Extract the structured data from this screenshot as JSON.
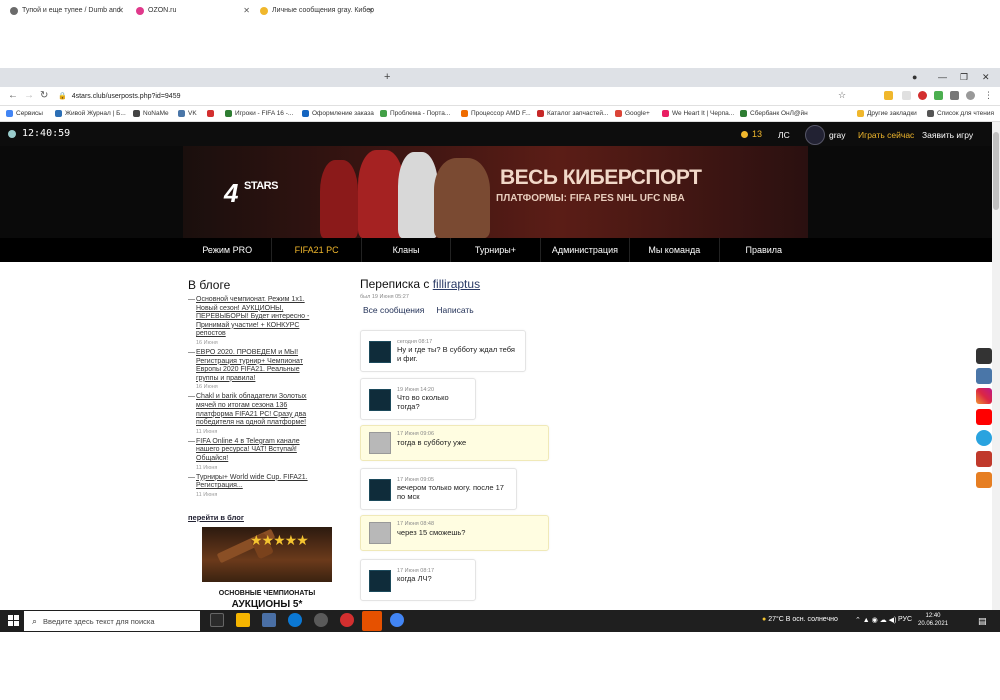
{
  "browser": {
    "tabs": [
      {
        "title": "Тупой и еще тупее / Dumb and",
        "icon_color": "#6b6b6b"
      },
      {
        "title": "OZON.ru",
        "icon_color": "#e0398b"
      },
      {
        "title": "Личные сообщения gray. Кибер",
        "icon_color": "#f0b72c"
      }
    ],
    "new_tab": "+",
    "url": "4stars.club/userposts.php?id=9459",
    "bookmarks": [
      {
        "label": "Сервисы",
        "color": "#4285f4"
      },
      {
        "label": "Живой Журнал | Б...",
        "color": "#2c6fb5"
      },
      {
        "label": "NoNaMe",
        "color": "#444444"
      },
      {
        "label": "VK",
        "color": "#4a76a8"
      },
      {
        "label": "",
        "color": "#d32f2f"
      },
      {
        "label": "Игроки - FIFA 16 -...",
        "color": "#2e7d32"
      },
      {
        "label": "Оформление заказа",
        "color": "#1565c0"
      },
      {
        "label": "Проблема - Порта...",
        "color": "#43a047"
      },
      {
        "label": "Процессор AMD F...",
        "color": "#ef6c00"
      },
      {
        "label": "Каталог запчастей...",
        "color": "#c62828"
      },
      {
        "label": "Google+",
        "color": "#db4437"
      },
      {
        "label": "We Heart It | Черпа...",
        "color": "#e91e63"
      },
      {
        "label": "Сбербанк ОнЛ@йн",
        "color": "#2e7d32"
      },
      {
        "label": "Другие закладки",
        "color": "#f0b72c"
      },
      {
        "label": "Список для чтения",
        "color": "#555555"
      }
    ]
  },
  "site": {
    "clock": "12:40:59",
    "coins": "13",
    "ls": "ЛС",
    "username": "gray",
    "play_now": "Играть сейчас",
    "claim_game": "Заявить игру",
    "logo_main": "4",
    "logo_text": "STARS",
    "banner_title": "ВЕСЬ КИБЕРСПОРТ",
    "banner_subtitle": "ПЛАТФОРМЫ: FIFA PES NHL UFC NBA",
    "menu": [
      "Режим PRO",
      "FIFA21 PC",
      "Кланы",
      "Турниры+",
      "Администрация",
      "Мы команда",
      "Правила"
    ]
  },
  "blog": {
    "title": "В блоге",
    "items": [
      {
        "text": "Основной чемпионат. Режим 1х1. Новый сезон! АУКЦИОНЫ, ПЕРЕВЫБОРЫ! Будет интересно - Принимай участие! + КОНКУРС репостов",
        "date": "16 Июня"
      },
      {
        "text": "ЕВРО 2020. ПРОВЕДЕМ и МЫ! Регистрация турнир+ Чемпионат Европы 2020 FIFA21. Реальные группы и правила!",
        "date": "16 Июня"
      },
      {
        "text": "Chakl и barik обладатели Золотых мячей по итогам сезона 136 платформа FIFA21 PC! Сразу два победителя на одной платформе!",
        "date": "11 Июня"
      },
      {
        "text": "FIFA Online 4 в Telegram канале нашего ресурса! ЧАТ! Вступай! Общайся!",
        "date": "11 Июня"
      },
      {
        "text": "Турниры+ World wide Cup. FIFA21. Регистрация...",
        "date": "11 Июня"
      }
    ],
    "go_to_blog": "перейти в блог",
    "promo_line1": "ОСНОВНЫЕ ЧЕМПИОНАТЫ",
    "promo_line2": "АУКЦИОНЫ 5*",
    "promo_stars": "★★★★★"
  },
  "conversation": {
    "title_prefix": "Переписка с",
    "partner": "filliraptus",
    "seen": "был 19 Июня 05:27",
    "tab_all": "Все сообщения",
    "tab_write": "Написать",
    "messages": [
      {
        "time": "сегодня 08:17",
        "text": "Ну и где ты? В субботу ждал тебя и фиг.",
        "mine": false
      },
      {
        "time": "19 Июня 14:20",
        "text": "Что во сколько тогда?",
        "mine": false
      },
      {
        "time": "17 Июня 09:06",
        "text": "тогда в субботу уже",
        "mine": true
      },
      {
        "time": "17 Июня 09:05",
        "text": "вечером только могу. после 17 по мск",
        "mine": false
      },
      {
        "time": "17 Июня 08:48",
        "text": "через 15 сможешь?",
        "mine": true
      },
      {
        "time": "17 Июня 08:17",
        "text": "когда ЛЧ?",
        "mine": false
      }
    ]
  },
  "taskbar": {
    "search_placeholder": "Введите здесь текст для поиска",
    "weather": "27°C  В осн. солнечно",
    "lang": "РУС",
    "time": "12:40",
    "date": "20.06.2021"
  }
}
